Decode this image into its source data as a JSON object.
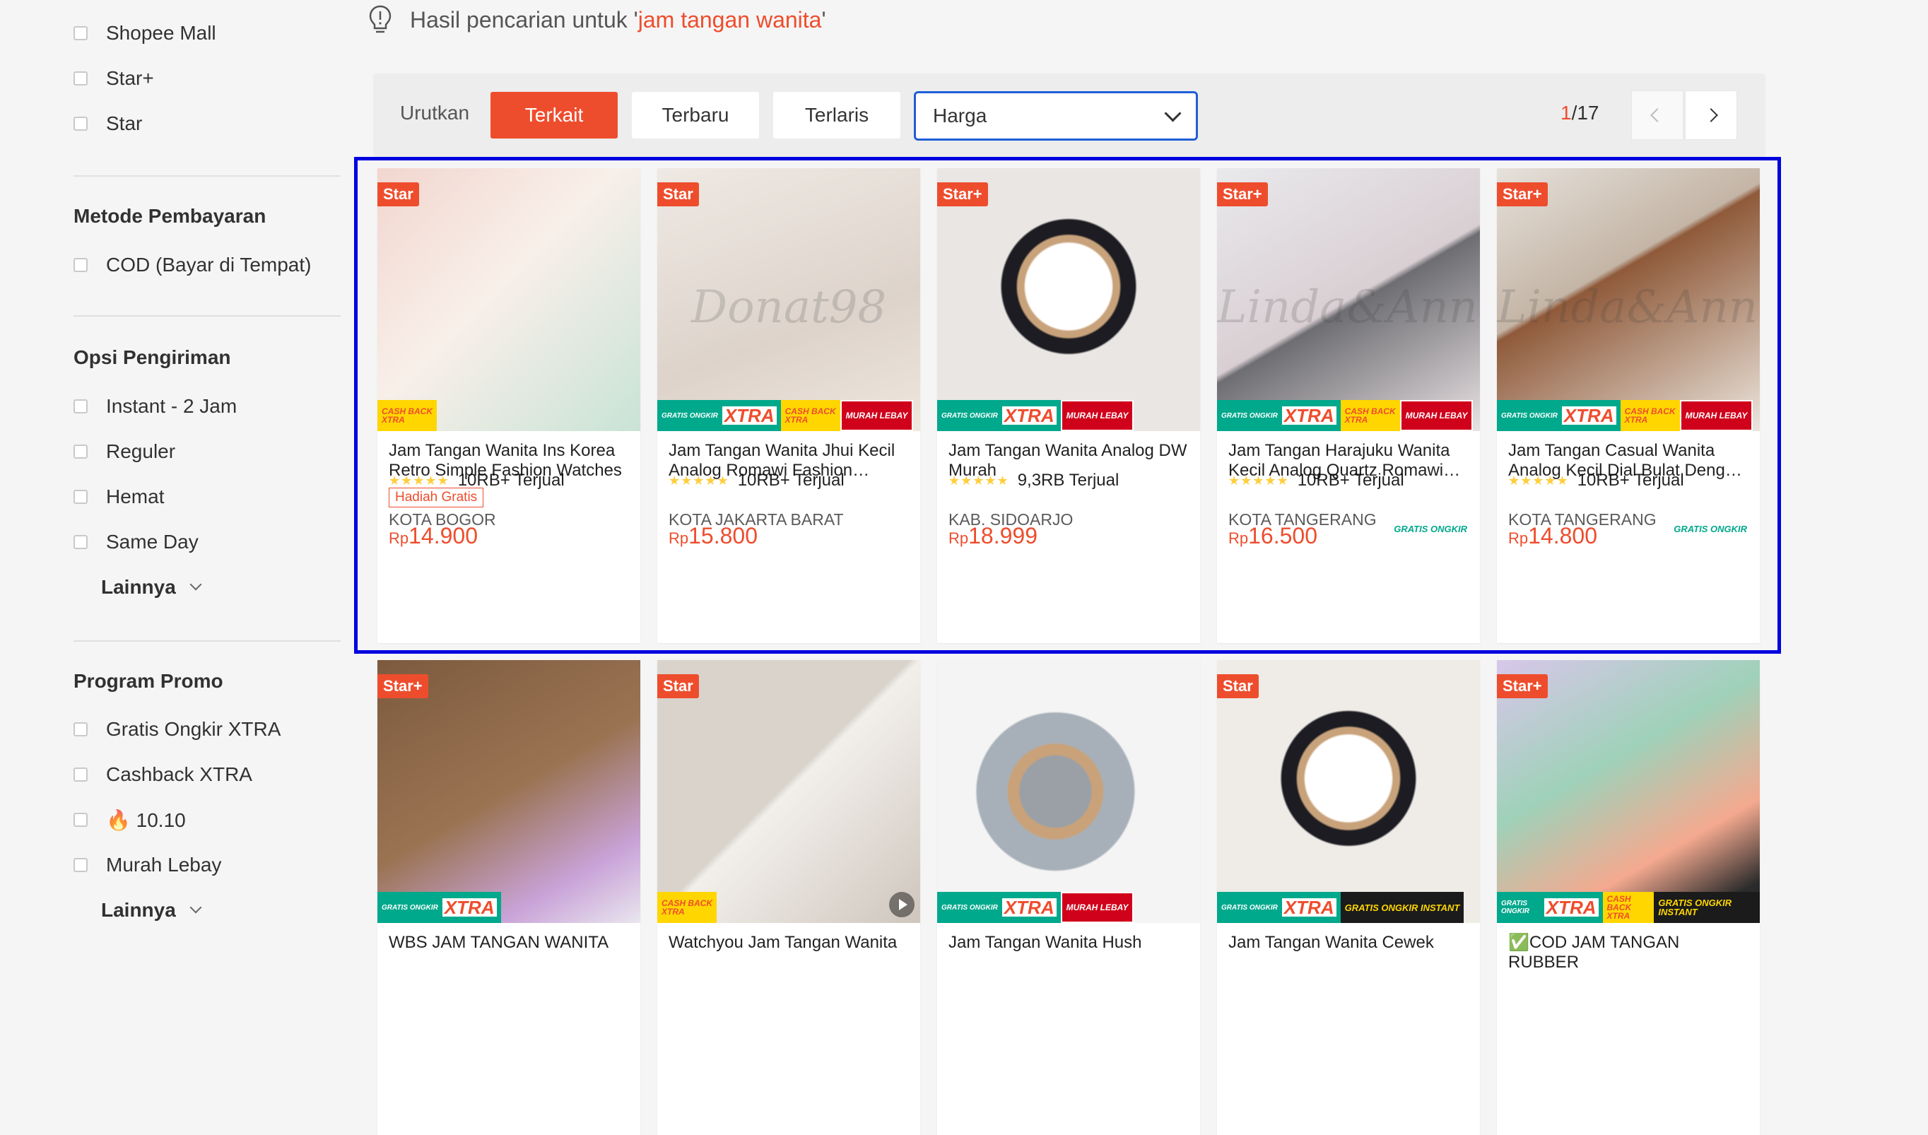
{
  "sidebar": {
    "top_filters": [
      "Shopee Mall",
      "Star+",
      "Star"
    ],
    "payment": {
      "title": "Metode Pembayaran",
      "options": [
        "COD (Bayar di Tempat)"
      ]
    },
    "shipping": {
      "title": "Opsi Pengiriman",
      "options": [
        "Instant - 2 Jam",
        "Reguler",
        "Hemat",
        "Same Day"
      ],
      "more": "Lainnya"
    },
    "promo": {
      "title": "Program Promo",
      "options": [
        "Gratis Ongkir XTRA",
        "Cashback XTRA",
        "🔥 10.10",
        "Murah Lebay"
      ],
      "more": "Lainnya"
    }
  },
  "search": {
    "prefix": "Hasil pencarian untuk '",
    "keyword": "jam tangan wanita",
    "suffix": "'"
  },
  "sort": {
    "label": "Urutkan",
    "options": [
      "Terkait",
      "Terbaru",
      "Terlaris"
    ],
    "active": "Terkait",
    "price_select": "Harga",
    "page_current": "1",
    "page_total": "/17"
  },
  "strip_text": {
    "gratis_ongkir": "GRATIS ONGKIR",
    "xtra": "XTRA",
    "cashback": "CASH BACK",
    "murah": "MURAH LEBAY",
    "instant": "GRATIS ONGKIR INSTANT"
  },
  "products": [
    {
      "badge": "Star",
      "name": "Jam Tangan Wanita Ins Korea Retro Simple Fashion Watches",
      "gift": "Hadiah Gratis",
      "currency": "Rp",
      "price": "14.900",
      "sold": "10RB+ Terjual",
      "location": "KOTA BOGOR",
      "rating": 5,
      "tags": [
        "cash"
      ]
    },
    {
      "badge": "Star",
      "name": "Jam Tangan Wanita Jhui Kecil Analog Romawi Fashion Wanita",
      "currency": "Rp",
      "price": "15.800",
      "sold": "10RB+ Terjual",
      "location": "KOTA JAKARTA BARAT",
      "rating": 5,
      "watermark": "Donat98",
      "tags": [
        "xtra",
        "cash",
        "murah"
      ]
    },
    {
      "badge": "Star+",
      "name": "Jam Tangan Wanita Analog DW Murah",
      "currency": "Rp",
      "price": "18.999",
      "sold": "9,3RB Terjual",
      "location": "KAB. SIDOARJO",
      "rating": 5,
      "tags": [
        "xtra",
        "murah"
      ]
    },
    {
      "badge": "Star+",
      "name": "Jam Tangan Harajuku Wanita Kecil Analog Quartz Romawi Fashion",
      "currency": "Rp",
      "price": "16.500",
      "gratis": "GRATIS ONGKIR",
      "sold": "10RB+ Terjual",
      "location": "KOTA TANGERANG",
      "rating": 5,
      "watermark": "Linda&Anne",
      "tags": [
        "xtra",
        "cash",
        "murah"
      ]
    },
    {
      "badge": "Star+",
      "name": "Jam Tangan Casual Wanita Analog Kecil Dial Bulat Dengan Tali",
      "currency": "Rp",
      "price": "14.800",
      "gratis": "GRATIS ONGKIR",
      "sold": "10RB+ Terjual",
      "location": "KOTA TANGERANG",
      "rating": 5,
      "watermark": "Linda&Anne",
      "tags": [
        "xtra",
        "cash",
        "murah"
      ]
    },
    {
      "badge": "Star+",
      "name": "WBS JAM TANGAN WANITA",
      "tags": [
        "xtra"
      ]
    },
    {
      "badge": "Star",
      "name": "Watchyou Jam Tangan Wanita",
      "tags": [
        "cash"
      ],
      "video": true
    },
    {
      "badge": "",
      "name": "Jam Tangan Wanita Hush",
      "tags": [
        "xtra",
        "murah"
      ]
    },
    {
      "badge": "Star",
      "name": "Jam Tangan Wanita Cewek",
      "tags": [
        "xtra",
        "instant"
      ]
    },
    {
      "badge": "Star+",
      "name": "✅COD JAM TANGAN RUBBER",
      "tags": [
        "xtra",
        "cash",
        "instant"
      ]
    }
  ],
  "colors": {
    "accent": "#ee4d2d",
    "highlight": "#0000e0",
    "xtra_green": "#00a88c",
    "star": "#ffce3d"
  }
}
